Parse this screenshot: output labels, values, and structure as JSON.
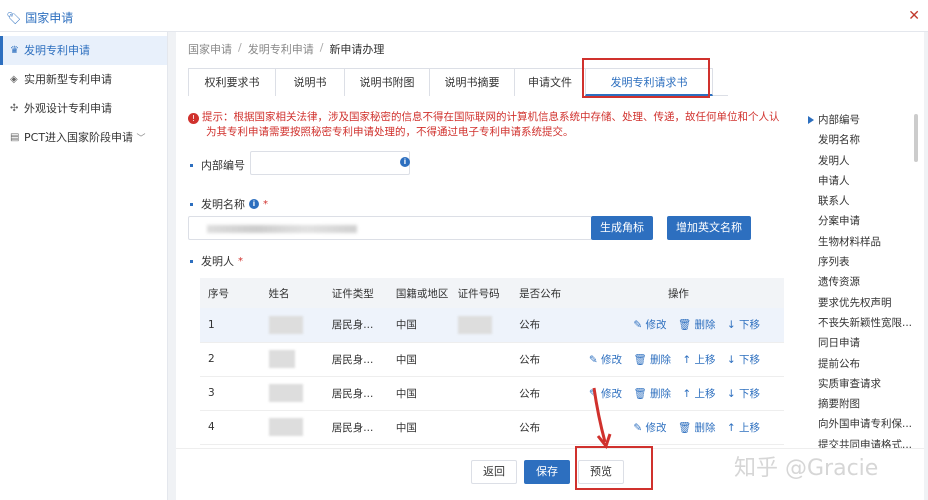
{
  "window": {
    "title": "国家申请"
  },
  "sidebar": {
    "items": [
      {
        "label": "发明专利申请",
        "icon": "trophy-icon",
        "active": true
      },
      {
        "label": "实用新型专利申请",
        "icon": "gem-icon"
      },
      {
        "label": "外观设计专利申请",
        "icon": "settings-icon"
      },
      {
        "label": "PCT进入国家阶段申请",
        "icon": "doc-icon"
      }
    ]
  },
  "breadcrumb": {
    "items": [
      "国家申请",
      "发明专利申请",
      "新申请办理"
    ]
  },
  "tabs": [
    "权利要求书",
    "说明书",
    "说明书附图",
    "说明书摘要",
    "申请文件",
    "发明专利请求书"
  ],
  "notice": {
    "line1": "提示：根据国家相关法律，涉及国家秘密的信息不得在国际联网的计算机信息系统中存储、处理、传递，故任何单位和个人认",
    "line2": "为其专利申请需要按照秘密专利申请处理的，不得通过电子专利申请系统提交。"
  },
  "form": {
    "internal_no_label": "内部编号",
    "invention_name_label": "发明名称",
    "inventor_label": "发明人",
    "gen_abbrev_btn": "生成角标",
    "add_english_btn": "增加英文名称"
  },
  "table": {
    "headers": [
      "序号",
      "姓名",
      "证件类型",
      "国籍或地区",
      "证件号码",
      "是否公布",
      "操作"
    ],
    "rows": [
      {
        "no": "1",
        "id_type": "居民身...",
        "nation": "中国",
        "publish": "公布"
      },
      {
        "no": "2",
        "id_type": "居民身...",
        "nation": "中国",
        "publish": "公布"
      },
      {
        "no": "3",
        "id_type": "居民身...",
        "nation": "中国",
        "publish": "公布"
      },
      {
        "no": "4",
        "id_type": "居民身...",
        "nation": "中国",
        "publish": "公布"
      }
    ],
    "ops": {
      "edit": "修改",
      "delete": "删除",
      "up": "上移",
      "down": "下移"
    }
  },
  "right_nav": [
    "内部编号",
    "发明名称",
    "发明人",
    "申请人",
    "联系人",
    "分案申请",
    "生物材料样品",
    "序列表",
    "遗传资源",
    "要求优先权声明",
    "不丧失新颖性宽限...",
    "同日申请",
    "提前公布",
    "实质审查请求",
    "摘要附图",
    "向外国申请专利保...",
    "提交共同申请格式..."
  ],
  "footer": {
    "back": "返回",
    "save": "保存",
    "preview": "预览"
  },
  "watermark": "知乎 @Gracie",
  "colors": {
    "accent": "#2d6fbf",
    "alert": "#d0312d"
  }
}
